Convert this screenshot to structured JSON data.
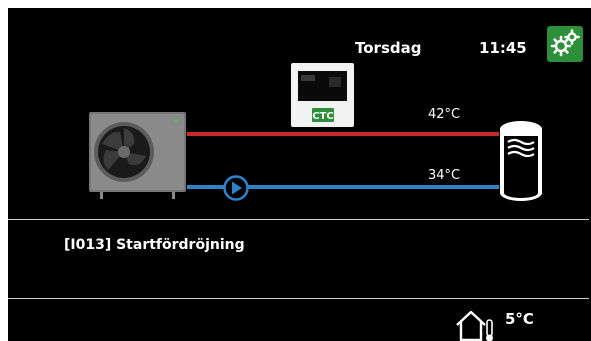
{
  "header": {
    "day": "Torsdag",
    "time": "11:45",
    "settings_icon": "gears-icon"
  },
  "diagram": {
    "display_brand": "CTC",
    "supply_temp": "42°C",
    "return_temp": "34°C",
    "colors": {
      "supply": "#cc2a2a",
      "return": "#2e82c9",
      "settings_button": "#2d8f3a"
    }
  },
  "alarm": {
    "message": "[I013] Startfördröjning"
  },
  "footer": {
    "outdoor_temp": "5°C",
    "outdoor_icon": "house-thermometer-icon"
  }
}
